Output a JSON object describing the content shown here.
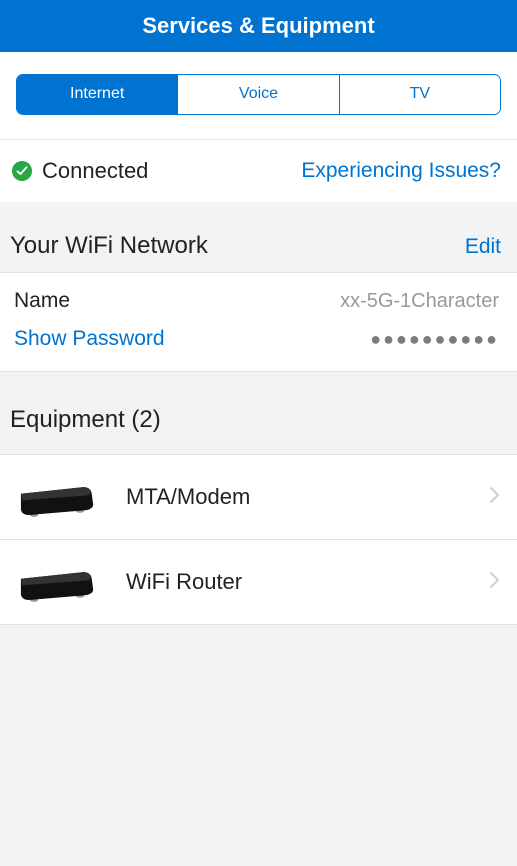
{
  "header": {
    "title": "Services & Equipment"
  },
  "tabs": {
    "items": [
      {
        "label": "Internet",
        "active": true
      },
      {
        "label": "Voice",
        "active": false
      },
      {
        "label": "TV",
        "active": false
      }
    ]
  },
  "status": {
    "connected_label": "Connected",
    "issues_link": "Experiencing Issues?"
  },
  "wifi": {
    "section_title": "Your WiFi Network",
    "edit_label": "Edit",
    "name_label": "Name",
    "name_value": "xx-5G-1Character",
    "show_password_label": "Show Password",
    "password_masked": "●●●●●●●●●●"
  },
  "equipment": {
    "section_title": "Equipment (2)",
    "items": [
      {
        "label": "MTA/Modem"
      },
      {
        "label": "WiFi Router"
      }
    ]
  }
}
